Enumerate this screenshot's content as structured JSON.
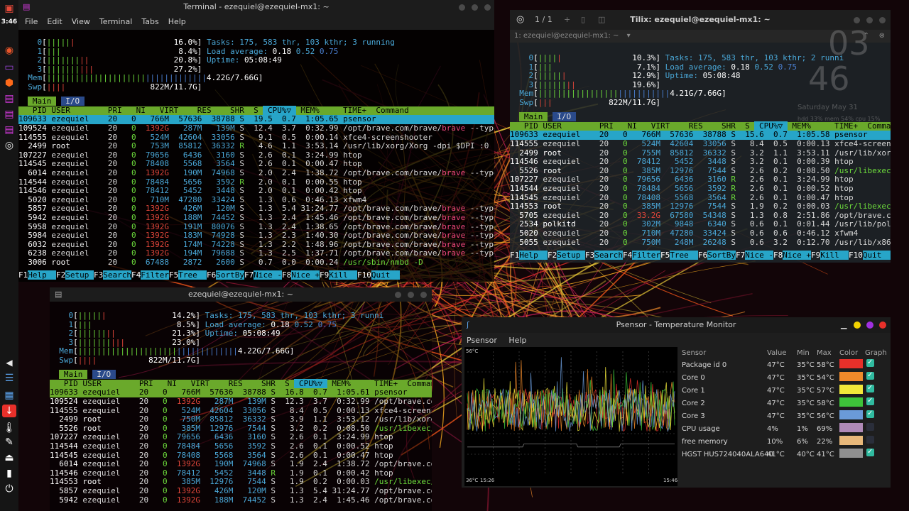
{
  "desktop": {
    "clock": "3:46"
  },
  "term1": {
    "title": "Terminal - ezequiel@ezequiel-mx1: ~",
    "menu": [
      "File",
      "Edit",
      "View",
      "Terminal",
      "Tabs",
      "Help"
    ],
    "cpu": [
      {
        "id": "0",
        "bars": "||||||",
        "pct": "16.0%"
      },
      {
        "id": "1",
        "bars": "|||",
        "pct": "8.4%"
      },
      {
        "id": "2",
        "bars": "|||||||||",
        "pct": "20.8%"
      },
      {
        "id": "3",
        "bars": "||||||||||",
        "pct": "27.2%"
      }
    ],
    "mem": {
      "label": "Mem",
      "bars": "||||||||||||||||||||||||||||||||||",
      "val": "4.22G/7.66G"
    },
    "swp": {
      "label": "Swp",
      "bars": "||||",
      "val": "822M/11.7G"
    },
    "tasks": "Tasks: 175, 583 thr, 103 kthr; 3 running",
    "load": {
      "label": "Load average:",
      "v1": "0.18",
      "v2": "0.52",
      "v3": "0.75"
    },
    "uptime": {
      "label": "Uptime:",
      "val": "05:08:49"
    },
    "tabs": [
      "Main",
      "I/O"
    ],
    "header": "  PID USER       PRI  NI  VIRT   RES   SHR S  CPU%▽MEM%   TIME+  Command",
    "rows": [
      {
        "pid": "109633",
        "user": "ezequiel",
        "pri": "20",
        "ni": "0",
        "virt": "766M",
        "res": "57636",
        "shr": "38788",
        "s": "S",
        "cpu": "19.5",
        "mem": "0.7",
        "time": "1:05.65",
        "cmd": "psensor"
      },
      {
        "pid": "109524",
        "user": "ezequiel",
        "pri": "20",
        "ni": "0",
        "virt": "1392G",
        "res": "287M",
        "shr": "139M",
        "s": "S",
        "cpu": "12.4",
        "mem": "3.7",
        "time": "0:32.99",
        "cmd": "/opt/brave.com/brave/brave --type"
      },
      {
        "pid": "114555",
        "user": "ezequiel",
        "pri": "20",
        "ni": "0",
        "virt": "524M",
        "res": "42604",
        "shr": "33056",
        "s": "S",
        "cpu": "9.1",
        "mem": "0.5",
        "time": "0:00.14",
        "cmd": "xfce4-screenshooter"
      },
      {
        "pid": "2499",
        "user": "root",
        "pri": "20",
        "ni": "0",
        "virt": "753M",
        "res": "85812",
        "shr": "36332",
        "s": "R",
        "cpu": "4.6",
        "mem": "1.1",
        "time": "3:53.14",
        "cmd": "/usr/lib/xorg/Xorg -dpi $DPI :0 -"
      },
      {
        "pid": "107227",
        "user": "ezequiel",
        "pri": "20",
        "ni": "0",
        "virt": "79656",
        "res": "6436",
        "shr": "3160",
        "s": "S",
        "cpu": "2.6",
        "mem": "0.1",
        "time": "3:24.99",
        "cmd": "htop"
      },
      {
        "pid": "114545",
        "user": "ezequiel",
        "pri": "20",
        "ni": "0",
        "virt": "78408",
        "res": "5568",
        "shr": "3564",
        "s": "S",
        "cpu": "2.6",
        "mem": "0.1",
        "time": "0:00.47",
        "cmd": "htop"
      },
      {
        "pid": "6014",
        "user": "ezequiel",
        "pri": "20",
        "ni": "0",
        "virt": "1392G",
        "res": "190M",
        "shr": "74968",
        "s": "S",
        "cpu": "2.0",
        "mem": "2.4",
        "time": "1:38.72",
        "cmd": "/opt/brave.com/brave/brave --type"
      },
      {
        "pid": "114544",
        "user": "ezequiel",
        "pri": "20",
        "ni": "0",
        "virt": "78484",
        "res": "5656",
        "shr": "3592",
        "s": "R",
        "cpu": "2.0",
        "mem": "0.1",
        "time": "0:00.55",
        "cmd": "htop"
      },
      {
        "pid": "114546",
        "user": "ezequiel",
        "pri": "20",
        "ni": "0",
        "virt": "78412",
        "res": "5452",
        "shr": "3448",
        "s": "S",
        "cpu": "2.0",
        "mem": "0.1",
        "time": "0:00.42",
        "cmd": "htop"
      },
      {
        "pid": "5020",
        "user": "ezequiel",
        "pri": "20",
        "ni": "0",
        "virt": "710M",
        "res": "47280",
        "shr": "33424",
        "s": "S",
        "cpu": "1.3",
        "mem": "0.6",
        "time": "0:46.13",
        "cmd": "xfwm4"
      },
      {
        "pid": "5857",
        "user": "ezequiel",
        "pri": "20",
        "ni": "0",
        "virt": "1392G",
        "res": "426M",
        "shr": "120M",
        "s": "S",
        "cpu": "1.3",
        "mem": "5.4",
        "time": "31:24.77",
        "cmd": "/opt/brave.com/brave/brave --type"
      },
      {
        "pid": "5942",
        "user": "ezequiel",
        "pri": "20",
        "ni": "0",
        "virt": "1392G",
        "res": "188M",
        "shr": "74452",
        "s": "S",
        "cpu": "1.3",
        "mem": "2.4",
        "time": "1:45.46",
        "cmd": "/opt/brave.com/brave/brave --type"
      },
      {
        "pid": "5958",
        "user": "ezequiel",
        "pri": "20",
        "ni": "0",
        "virt": "1392G",
        "res": "191M",
        "shr": "80076",
        "s": "S",
        "cpu": "1.3",
        "mem": "2.4",
        "time": "1:38.65",
        "cmd": "/opt/brave.com/brave/brave --type"
      },
      {
        "pid": "5984",
        "user": "ezequiel",
        "pri": "20",
        "ni": "0",
        "virt": "1392G",
        "res": "183M",
        "shr": "74928",
        "s": "S",
        "cpu": "1.3",
        "mem": "2.3",
        "time": "1:40.30",
        "cmd": "/opt/brave.com/brave/brave --type"
      },
      {
        "pid": "6032",
        "user": "ezequiel",
        "pri": "20",
        "ni": "0",
        "virt": "1392G",
        "res": "174M",
        "shr": "74228",
        "s": "S",
        "cpu": "1.3",
        "mem": "2.2",
        "time": "1:48.96",
        "cmd": "/opt/brave.com/brave/brave --type"
      },
      {
        "pid": "6238",
        "user": "ezequiel",
        "pri": "20",
        "ni": "0",
        "virt": "1392G",
        "res": "194M",
        "shr": "79688",
        "s": "S",
        "cpu": "1.3",
        "mem": "2.5",
        "time": "1:37.71",
        "cmd": "/opt/brave.com/brave/brave --type"
      },
      {
        "pid": "3006",
        "user": "root",
        "pri": "20",
        "ni": "0",
        "virt": "67488",
        "res": "2872",
        "shr": "2600",
        "s": "S",
        "cpu": "0.7",
        "mem": "0.0",
        "time": "0:00.24",
        "cmd": "/usr/sbin/nmbd -D"
      }
    ],
    "fkeys": [
      [
        "F1",
        "Help"
      ],
      [
        "F2",
        "Setup"
      ],
      [
        "F3",
        "Search"
      ],
      [
        "F4",
        "Filter"
      ],
      [
        "F5",
        "Tree"
      ],
      [
        "F6",
        "SortBy"
      ],
      [
        "F7",
        "Nice -"
      ],
      [
        "F8",
        "Nice +"
      ],
      [
        "F9",
        "Kill"
      ],
      [
        "F10",
        "Quit"
      ]
    ]
  },
  "tilix": {
    "title": "Tilix: ezequiel@ezequiel-mx1: ~",
    "counter": "1 / 1",
    "tab": "1: ezequiel@ezequiel-mx1: ~",
    "cpu": [
      {
        "id": "0",
        "bars": "|||||",
        "pct": "10.3%"
      },
      {
        "id": "1",
        "bars": "|||",
        "pct": "7.1%"
      },
      {
        "id": "2",
        "bars": "||||||",
        "pct": "12.9%"
      },
      {
        "id": "3",
        "bars": "||||||||",
        "pct": "19.6%"
      }
    ],
    "mem": {
      "label": "Mem",
      "bars": "||||||||||||||||||||||||||||",
      "val": "4.21G/7.66G"
    },
    "swp": {
      "label": "Swp",
      "bars": "|||",
      "val": "822M/11.7G"
    },
    "tasks": "Tasks: 175, 583 thr, 103 kthr; 2 runni",
    "load": {
      "label": "Load average:",
      "v1": "0.18",
      "v2": "0.52",
      "v3": "0.75"
    },
    "uptime": {
      "label": "Uptime:",
      "val": "05:08:48"
    },
    "conky": {
      "hour": "03",
      "min": "46",
      "date": "Saturday  May 31",
      "stats": "hdd 33%  mem 54%  cpu 15%"
    },
    "tabs": [
      "Main",
      "I/O"
    ],
    "rows": [
      {
        "pid": "109633",
        "user": "ezequiel",
        "pri": "20",
        "ni": "0",
        "virt": "766M",
        "res": "57636",
        "shr": "38788",
        "s": "S",
        "cpu": "15.6",
        "mem": "0.7",
        "time": "1:05.58",
        "cmd": "psensor"
      },
      {
        "pid": "114555",
        "user": "ezequiel",
        "pri": "20",
        "ni": "0",
        "virt": "524M",
        "res": "42604",
        "shr": "33056",
        "s": "S",
        "cpu": "8.4",
        "mem": "0.5",
        "time": "0:00.13",
        "cmd": "xfce4-screens"
      },
      {
        "pid": "2499",
        "user": "root",
        "pri": "20",
        "ni": "0",
        "virt": "755M",
        "res": "85812",
        "shr": "36332",
        "s": "S",
        "cpu": "3.2",
        "mem": "1.1",
        "time": "3:53.11",
        "cmd": "/usr/lib/xorg"
      },
      {
        "pid": "114546",
        "user": "ezequiel",
        "pri": "20",
        "ni": "0",
        "virt": "78412",
        "res": "5452",
        "shr": "3448",
        "s": "S",
        "cpu": "3.2",
        "mem": "0.1",
        "time": "0:00.39",
        "cmd": "htop"
      },
      {
        "pid": "5526",
        "user": "root",
        "pri": "20",
        "ni": "0",
        "virt": "385M",
        "res": "12976",
        "shr": "7544",
        "s": "S",
        "cpu": "2.6",
        "mem": "0.2",
        "time": "0:08.50",
        "cmd": "/usr/libexec/"
      },
      {
        "pid": "107227",
        "user": "ezequiel",
        "pri": "20",
        "ni": "0",
        "virt": "79656",
        "res": "6436",
        "shr": "3160",
        "s": "R",
        "cpu": "2.6",
        "mem": "0.1",
        "time": "3:24.99",
        "cmd": "htop"
      },
      {
        "pid": "114544",
        "user": "ezequiel",
        "pri": "20",
        "ni": "0",
        "virt": "78484",
        "res": "5656",
        "shr": "3592",
        "s": "R",
        "cpu": "2.6",
        "mem": "0.1",
        "time": "0:00.52",
        "cmd": "htop"
      },
      {
        "pid": "114545",
        "user": "ezequiel",
        "pri": "20",
        "ni": "0",
        "virt": "78408",
        "res": "5568",
        "shr": "3564",
        "s": "R",
        "cpu": "2.6",
        "mem": "0.1",
        "time": "0:00.47",
        "cmd": "htop"
      },
      {
        "pid": "114553",
        "user": "root",
        "pri": "20",
        "ni": "0",
        "virt": "385M",
        "res": "12976",
        "shr": "7544",
        "s": "S",
        "cpu": "1.9",
        "mem": "0.2",
        "time": "0:00.03",
        "cmd": "/usr/libexec/"
      },
      {
        "pid": "5705",
        "user": "ezequiel",
        "pri": "20",
        "ni": "0",
        "virt": "33.2G",
        "res": "67580",
        "shr": "54348",
        "s": "S",
        "cpu": "1.3",
        "mem": "0.8",
        "time": "2:51.86",
        "cmd": "/opt/brave.co"
      },
      {
        "pid": "2534",
        "user": "polkitd",
        "pri": "20",
        "ni": "0",
        "virt": "302M",
        "res": "9848",
        "shr": "6340",
        "s": "S",
        "cpu": "0.6",
        "mem": "0.1",
        "time": "0:01.44",
        "cmd": "/usr/lib/polk"
      },
      {
        "pid": "5020",
        "user": "ezequiel",
        "pri": "20",
        "ni": "0",
        "virt": "710M",
        "res": "47280",
        "shr": "33424",
        "s": "S",
        "cpu": "0.6",
        "mem": "0.6",
        "time": "0:46.12",
        "cmd": "xfwm4"
      },
      {
        "pid": "5055",
        "user": "ezequiel",
        "pri": "20",
        "ni": "0",
        "virt": "750M",
        "res": "248M",
        "shr": "26248",
        "s": "S",
        "cpu": "0.6",
        "mem": "3.2",
        "time": "0:12.70",
        "cmd": "/usr/lib/x86"
      }
    ],
    "fkeys": [
      [
        "F1",
        "Help"
      ],
      [
        "F2",
        "Setup"
      ],
      [
        "F3",
        "Search"
      ],
      [
        "F4",
        "Filter"
      ],
      [
        "F5",
        "Tree"
      ],
      [
        "F6",
        "SortBy"
      ],
      [
        "F7",
        "Nice -"
      ],
      [
        "F8",
        "Nice +"
      ],
      [
        "F9",
        "Kill"
      ],
      [
        "F10",
        "Quit"
      ]
    ]
  },
  "term3": {
    "title": "ezequiel@ezequiel-mx1: ~",
    "cpu": [
      {
        "id": "0",
        "bars": "||||||",
        "pct": "14.2%"
      },
      {
        "id": "1",
        "bars": "|||",
        "pct": "8.5%"
      },
      {
        "id": "2",
        "bars": "||||||||",
        "pct": "21.3%"
      },
      {
        "id": "3",
        "bars": "||||||||||",
        "pct": "23.0%"
      }
    ],
    "mem": {
      "label": "Mem",
      "bars": "||||||||||||||||||||||||||||||||||",
      "val": "4.22G/7.66G"
    },
    "swp": {
      "label": "Swp",
      "bars": "||||",
      "val": "822M/11.7G"
    },
    "tasks": "Tasks: 175, 583 thr, 103 kthr; 3 runni",
    "load": {
      "label": "Load average:",
      "v1": "0.18",
      "v2": "0.52",
      "v3": "0.75"
    },
    "uptime": {
      "label": "Uptime:",
      "val": "05:08:49"
    },
    "tabs": [
      "Main",
      "I/O"
    ],
    "rows": [
      {
        "pid": "109633",
        "user": "ezequiel",
        "pri": "20",
        "ni": "0",
        "virt": "766M",
        "res": "57636",
        "shr": "38788",
        "s": "S",
        "cpu": "16.8",
        "mem": "0.7",
        "time": "1:05.61",
        "cmd": "psensor"
      },
      {
        "pid": "109524",
        "user": "ezequiel",
        "pri": "20",
        "ni": "0",
        "virt": "1392G",
        "res": "287M",
        "shr": "139M",
        "s": "S",
        "cpu": "12.3",
        "mem": "3.7",
        "time": "0:32.99",
        "cmd": "/opt/brave.co"
      },
      {
        "pid": "114555",
        "user": "ezequiel",
        "pri": "20",
        "ni": "0",
        "virt": "524M",
        "res": "42604",
        "shr": "33056",
        "s": "S",
        "cpu": "8.4",
        "mem": "0.5",
        "time": "0:00.13",
        "cmd": "xfce4-screens"
      },
      {
        "pid": "2499",
        "user": "root",
        "pri": "20",
        "ni": "0",
        "virt": "750M",
        "res": "85812",
        "shr": "36332",
        "s": "S",
        "cpu": "3.9",
        "mem": "1.1",
        "time": "3:53.12",
        "cmd": "/usr/lib/xorg"
      },
      {
        "pid": "5526",
        "user": "root",
        "pri": "20",
        "ni": "0",
        "virt": "385M",
        "res": "12976",
        "shr": "7544",
        "s": "S",
        "cpu": "3.2",
        "mem": "0.2",
        "time": "0:08.50",
        "cmd": "/usr/libexec/"
      },
      {
        "pid": "107227",
        "user": "ezequiel",
        "pri": "20",
        "ni": "0",
        "virt": "79656",
        "res": "6436",
        "shr": "3160",
        "s": "S",
        "cpu": "2.6",
        "mem": "0.1",
        "time": "3:24.99",
        "cmd": "htop"
      },
      {
        "pid": "114544",
        "user": "ezequiel",
        "pri": "20",
        "ni": "0",
        "virt": "78484",
        "res": "5656",
        "shr": "3592",
        "s": "S",
        "cpu": "2.6",
        "mem": "0.1",
        "time": "0:00.52",
        "cmd": "htop"
      },
      {
        "pid": "114545",
        "user": "ezequiel",
        "pri": "20",
        "ni": "0",
        "virt": "78408",
        "res": "5568",
        "shr": "3564",
        "s": "S",
        "cpu": "2.6",
        "mem": "0.1",
        "time": "0:00.47",
        "cmd": "htop"
      },
      {
        "pid": "6014",
        "user": "ezequiel",
        "pri": "20",
        "ni": "0",
        "virt": "1392G",
        "res": "190M",
        "shr": "74968",
        "s": "S",
        "cpu": "1.9",
        "mem": "2.4",
        "time": "1:38.72",
        "cmd": "/opt/brave.co"
      },
      {
        "pid": "114546",
        "user": "ezequiel",
        "pri": "20",
        "ni": "0",
        "virt": "78412",
        "res": "5452",
        "shr": "3448",
        "s": "R",
        "cpu": "1.9",
        "mem": "0.1",
        "time": "0:00.42",
        "cmd": "htop"
      },
      {
        "pid": "114553",
        "user": "root",
        "pri": "20",
        "ni": "0",
        "virt": "385M",
        "res": "12976",
        "shr": "7544",
        "s": "S",
        "cpu": "1.9",
        "mem": "0.2",
        "time": "0:00.03",
        "cmd": "/usr/libexec/"
      },
      {
        "pid": "5857",
        "user": "ezequiel",
        "pri": "20",
        "ni": "0",
        "virt": "1392G",
        "res": "426M",
        "shr": "120M",
        "s": "S",
        "cpu": "1.3",
        "mem": "5.4",
        "time": "31:24.77",
        "cmd": "/opt/brave.co"
      },
      {
        "pid": "5942",
        "user": "ezequiel",
        "pri": "20",
        "ni": "0",
        "virt": "1392G",
        "res": "188M",
        "shr": "74452",
        "s": "S",
        "cpu": "1.3",
        "mem": "2.4",
        "time": "1:45.46",
        "cmd": "/opt/brave.co"
      }
    ]
  },
  "psensor": {
    "title": "Psensor - Temperature Monitor",
    "menu": [
      "Psensor",
      "Help"
    ],
    "graph": {
      "ymax": "56°C",
      "ymin": "36°C",
      "xstart": "15:26",
      "xend": "15:46"
    },
    "columns": [
      "Sensor",
      "Value",
      "Min",
      "Max",
      "Color",
      "Graph"
    ],
    "sensors": [
      {
        "name": "Package id 0",
        "value": "47°C",
        "min": "35°C",
        "max": "58°C",
        "color": "#e8302a",
        "graph": true
      },
      {
        "name": "Core 0",
        "value": "47°C",
        "min": "35°C",
        "max": "54°C",
        "color": "#f08a2a",
        "graph": true
      },
      {
        "name": "Core 1",
        "value": "47°C",
        "min": "35°C",
        "max": "57°C",
        "color": "#f2e83a",
        "graph": true
      },
      {
        "name": "Core 2",
        "value": "47°C",
        "min": "35°C",
        "max": "58°C",
        "color": "#3ec43a",
        "graph": true
      },
      {
        "name": "Core 3",
        "value": "47°C",
        "min": "35°C",
        "max": "56°C",
        "color": "#6a9ad8",
        "graph": true
      },
      {
        "name": "CPU usage",
        "value": "4%",
        "min": "1%",
        "max": "69%",
        "color": "#b08ab8",
        "graph": false
      },
      {
        "name": "free memory",
        "value": "10%",
        "min": "6%",
        "max": "22%",
        "color": "#e8b87a",
        "graph": false
      },
      {
        "name": "HGST HUS724040ALA640",
        "value": "41°C",
        "min": "40°C",
        "max": "41°C",
        "color": "#909090",
        "graph": true
      }
    ]
  }
}
